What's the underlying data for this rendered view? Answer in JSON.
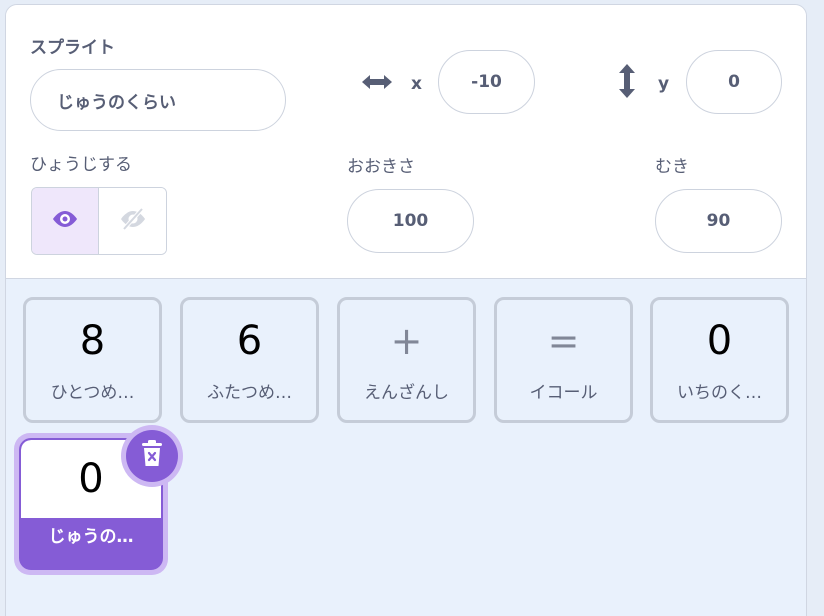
{
  "sprite_info": {
    "sprite_label": "スプライト",
    "sprite_name": "じゅうのくらい",
    "x_label": "x",
    "x_value": "-10",
    "y_label": "y",
    "y_value": "0",
    "show_label": "ひょうじする",
    "size_label": "おおきさ",
    "size_value": "100",
    "direction_label": "むき",
    "direction_value": "90"
  },
  "sprites": [
    {
      "costume": "8",
      "name": "ひとつめ…"
    },
    {
      "costume": "6",
      "name": "ふたつめ…"
    },
    {
      "costume": "+",
      "name": "えんざんし"
    },
    {
      "costume": "=",
      "name": "イコール"
    },
    {
      "costume": "0",
      "name": "いちのく…"
    }
  ],
  "selected_sprite": {
    "costume": "0",
    "name": "じゅうの…"
  },
  "colors": {
    "accent": "#855cd6",
    "accent_light": "#cdb8f3",
    "text": "#575e75",
    "panel_bg": "#e9f1fc",
    "border": "#cdd3de"
  },
  "icons": {
    "x_axis": "horizontal-arrows-icon",
    "y_axis": "vertical-arrows-icon",
    "show": "eye-icon",
    "hide": "eye-off-icon",
    "delete": "trash-icon"
  }
}
